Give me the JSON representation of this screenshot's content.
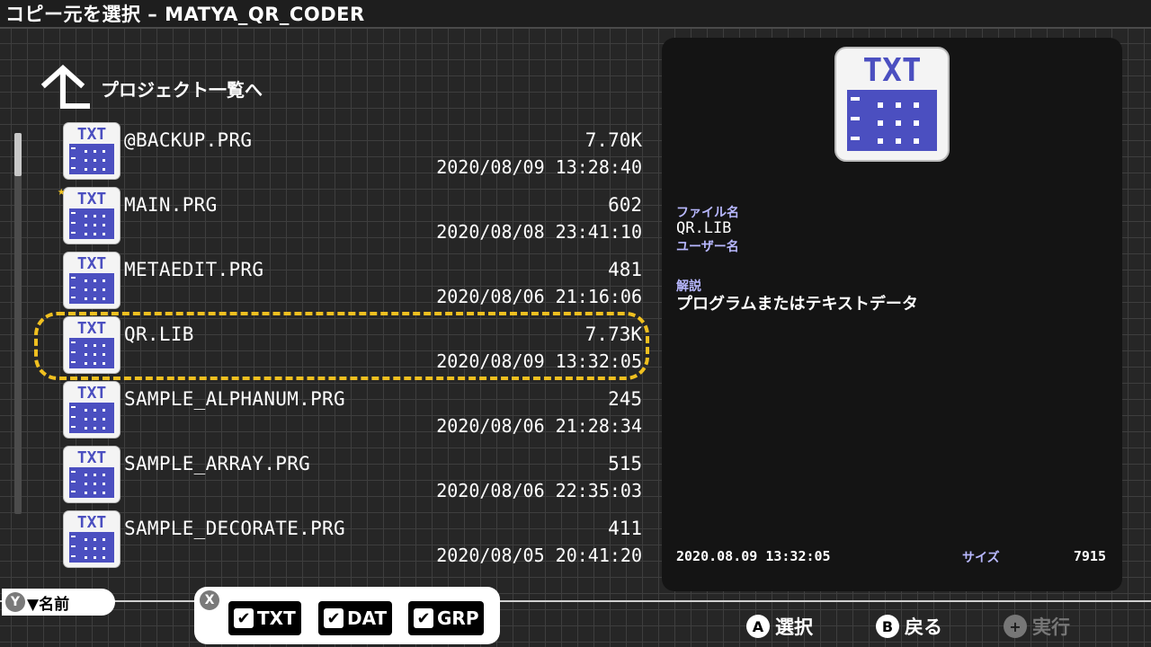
{
  "window": {
    "title": "コピー元を選択 – MATYA_QR_CODER"
  },
  "nav": {
    "back_label": "プロジェクト一覧へ"
  },
  "icon_label": "TXT",
  "files": [
    {
      "name": "@BACKUP.PRG",
      "size": "7.70K",
      "date": "2020/08/09 13:28:40",
      "starred": false
    },
    {
      "name": "MAIN.PRG",
      "size": "602",
      "date": "2020/08/08 23:41:10",
      "starred": true
    },
    {
      "name": "METAEDIT.PRG",
      "size": "481",
      "date": "2020/08/06 21:16:06",
      "starred": false
    },
    {
      "name": "QR.LIB",
      "size": "7.73K",
      "date": "2020/08/09 13:32:05",
      "starred": false,
      "selected": true
    },
    {
      "name": "SAMPLE_ALPHANUM.PRG",
      "size": "245",
      "date": "2020/08/06 21:28:34",
      "starred": false
    },
    {
      "name": "SAMPLE_ARRAY.PRG",
      "size": "515",
      "date": "2020/08/06 22:35:03",
      "starred": false
    },
    {
      "name": "SAMPLE_DECORATE.PRG",
      "size": "411",
      "date": "2020/08/05 20:41:20",
      "starred": false
    }
  ],
  "detail": {
    "filename_label": "ファイル名",
    "filename": "QR.LIB",
    "user_label": "ユーザー名",
    "user": "",
    "desc_label": "解説",
    "desc": "プログラムまたはテキストデータ",
    "timestamp": "2020.08.09  13:32:05",
    "size_label": "サイズ",
    "size": "7915"
  },
  "sort": {
    "button": "Y",
    "label": "▼名前"
  },
  "filter": {
    "button": "X",
    "options": [
      {
        "label": "TXT",
        "checked": true
      },
      {
        "label": "DAT",
        "checked": true
      },
      {
        "label": "GRP",
        "checked": true
      }
    ]
  },
  "hints": {
    "select": {
      "button": "A",
      "label": "選択"
    },
    "back": {
      "button": "B",
      "label": "戻る"
    },
    "run": {
      "button": "+",
      "label": "実行"
    }
  },
  "colors": {
    "icon_blue": "#4b4fc0",
    "selection": "#f0c020",
    "label_blue": "#b8b8ff",
    "star": "#f3c623"
  }
}
